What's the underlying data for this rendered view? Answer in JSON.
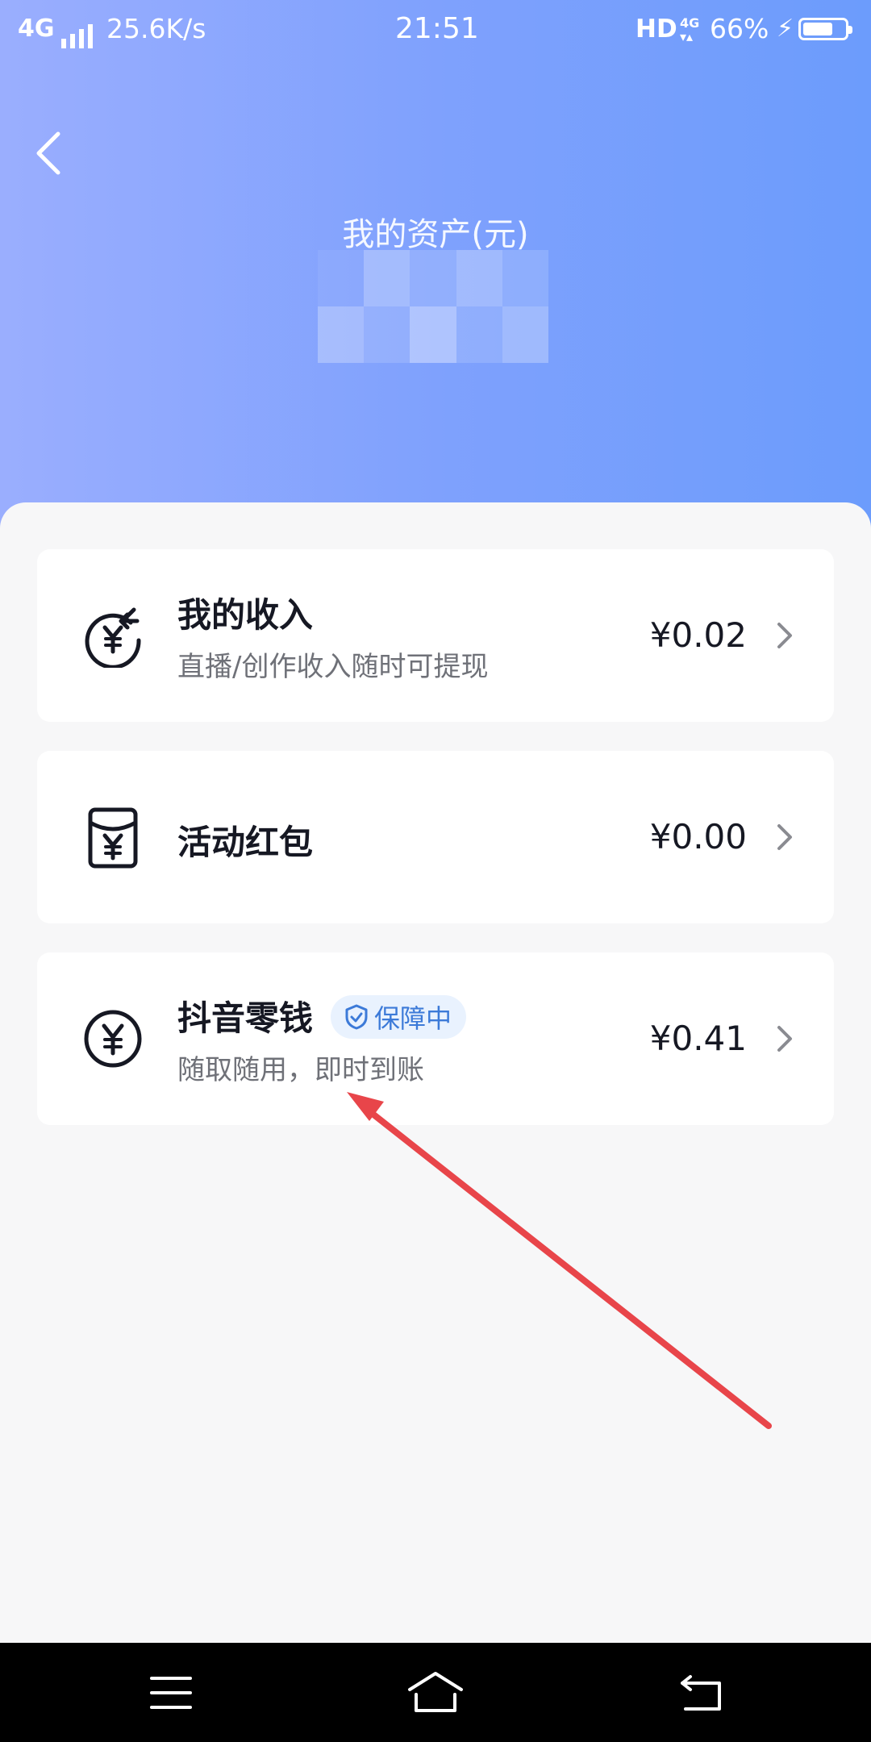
{
  "status_bar": {
    "network": "4G",
    "speed": "25.6K/s",
    "time": "21:51",
    "hd": "HD",
    "net_small": "4G",
    "battery": "66%"
  },
  "header": {
    "title": "我的资产(元)"
  },
  "items": [
    {
      "title": "我的收入",
      "subtitle": "直播/创作收入随时可提现",
      "amount": "¥0.02",
      "icon": "yuan-refresh-icon"
    },
    {
      "title": "活动红包",
      "subtitle": "",
      "amount": "¥0.00",
      "icon": "red-envelope-icon"
    },
    {
      "title": "抖音零钱",
      "badge": "保障中",
      "subtitle": "随取随用，即时到账",
      "amount": "¥0.41",
      "icon": "yuan-circle-icon"
    }
  ],
  "colors": {
    "hero_start": "#9aaefe",
    "hero_end": "#6c9cfc",
    "badge_text": "#3c7ad8",
    "annotation_arrow": "#e8454a"
  }
}
